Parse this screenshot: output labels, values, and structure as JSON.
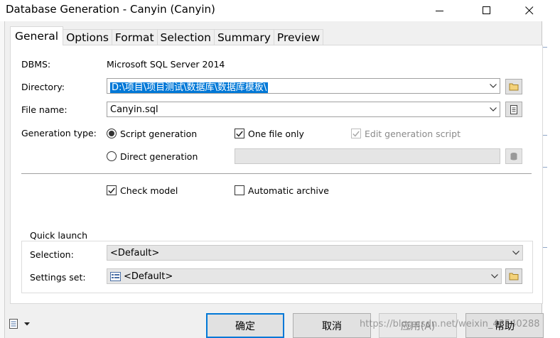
{
  "window": {
    "title": "Database Generation - Canyin (Canyin)"
  },
  "tabs": [
    "General",
    "Options",
    "Format",
    "Selection",
    "Summary",
    "Preview"
  ],
  "general": {
    "dbms_label": "DBMS:",
    "dbms_value": "Microsoft SQL Server 2014",
    "directory_label": "Directory:",
    "directory_value": "D:\\项目\\项目测试\\数据库\\数据库模板\\",
    "filename_label": "File name:",
    "filename_value": "Canyin.sql",
    "gentype_label": "Generation type:",
    "script_generation": "Script generation",
    "direct_generation": "Direct generation",
    "one_file_only": "One file only",
    "edit_generation_script": "Edit generation script",
    "check_model": "Check model",
    "automatic_archive": "Automatic archive"
  },
  "quick_launch": {
    "title": "Quick launch",
    "selection_label": "Selection:",
    "selection_value": "<Default>",
    "settings_label": "Settings set:",
    "settings_value": "<Default>"
  },
  "buttons": {
    "ok": "确定",
    "cancel": "取消",
    "apply": "应用(A)",
    "help": "帮助"
  },
  "watermark": "https://blog.csdn.net/weixin_43540288",
  "colors": {
    "accent": "#0078d7",
    "selection_bg": "#0078d7"
  }
}
